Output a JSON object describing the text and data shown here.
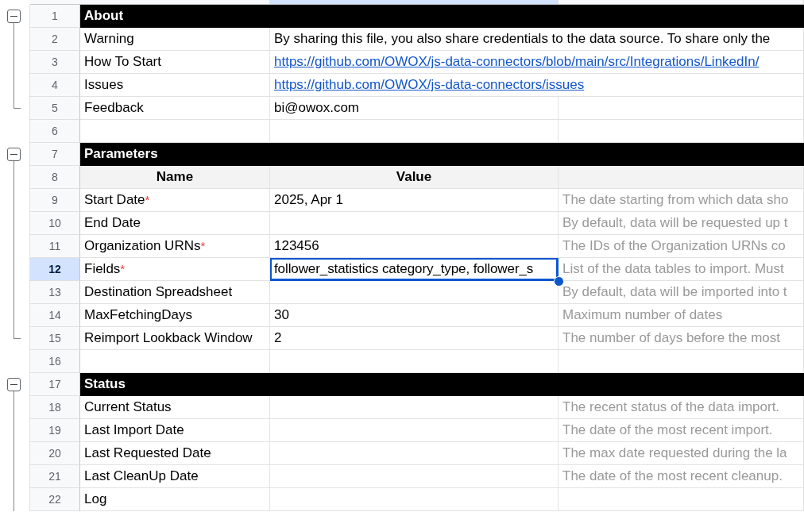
{
  "column_headers": [
    {
      "selected": false
    },
    {
      "selected": true
    },
    {
      "selected": false
    }
  ],
  "blocks": [
    {
      "kind": "group",
      "expanded": true,
      "continues": false,
      "rows": [
        {
          "number": "1",
          "kind": "section",
          "selected": false,
          "title": "About"
        },
        {
          "number": "2",
          "kind": "note",
          "selected": false,
          "name": "Warning",
          "value": "By sharing this file, you also share credentials to the data source. To share only the"
        },
        {
          "number": "3",
          "kind": "link",
          "selected": false,
          "name": "How To Start",
          "value": "https://github.com/OWOX/js-data-connectors/blob/main/src/Integrations/LinkedIn/"
        },
        {
          "number": "4",
          "kind": "link",
          "selected": false,
          "name": "Issues",
          "value": "https://github.com/OWOX/js-data-connectors/issues"
        },
        {
          "number": "5",
          "kind": "contact",
          "selected": false,
          "name": "Feedback",
          "value": "bi@owox.com"
        }
      ]
    },
    {
      "kind": "plain",
      "rows": [
        {
          "number": "6",
          "kind": "blank",
          "selected": false
        }
      ]
    },
    {
      "kind": "group",
      "expanded": true,
      "continues": false,
      "rows": [
        {
          "number": "7",
          "kind": "section",
          "selected": false,
          "title": "Parameters"
        },
        {
          "number": "8",
          "kind": "heads",
          "selected": false,
          "name": "Name",
          "value": "Value"
        },
        {
          "number": "9",
          "kind": "param",
          "selected": false,
          "name": "Start Date",
          "required_mark": "*",
          "value": "2025, Apr 1",
          "description": "The date starting from which data sho"
        },
        {
          "number": "10",
          "kind": "param",
          "selected": false,
          "name": "End Date",
          "description": "By default, data will be requested up t"
        },
        {
          "number": "11",
          "kind": "param",
          "selected": false,
          "name": "Organization URNs",
          "required_mark": "*",
          "value": "123456",
          "description": "The IDs of the Organization URNs co"
        },
        {
          "number": "12",
          "kind": "param",
          "selected": true,
          "name": "Fields",
          "required_mark": "*",
          "value": "follower_statistics category_type, follower_s",
          "description": "List of the data tables to import. Must"
        },
        {
          "number": "13",
          "kind": "param",
          "selected": false,
          "name": "Destination Spreadsheet",
          "description": "By default, data will be imported into t"
        },
        {
          "number": "14",
          "kind": "param",
          "selected": false,
          "name": "MaxFetchingDays",
          "value": "30",
          "description": "Maximum number of dates"
        },
        {
          "number": "15",
          "kind": "param",
          "selected": false,
          "name": "Reimport Lookback Window",
          "value": "2",
          "description": "The number of days before the most"
        }
      ]
    },
    {
      "kind": "plain",
      "rows": [
        {
          "number": "16",
          "kind": "blank",
          "selected": false
        }
      ]
    },
    {
      "kind": "group",
      "expanded": true,
      "continues": true,
      "rows": [
        {
          "number": "17",
          "kind": "section",
          "selected": false,
          "title": "Status"
        },
        {
          "number": "18",
          "kind": "param",
          "selected": false,
          "name": "Current Status",
          "description": "The recent status of the data import."
        },
        {
          "number": "19",
          "kind": "param",
          "selected": false,
          "name": "Last Import Date",
          "description": "The date of the most recent import."
        },
        {
          "number": "20",
          "kind": "param",
          "selected": false,
          "name": "Last Requested Date",
          "description": "The max date requested during the la"
        },
        {
          "number": "21",
          "kind": "param",
          "selected": false,
          "name": "Last CleanUp Date",
          "description": "The date of the most recent cleanup."
        },
        {
          "number": "22",
          "kind": "param",
          "selected": false,
          "name": "Log"
        }
      ]
    }
  ]
}
